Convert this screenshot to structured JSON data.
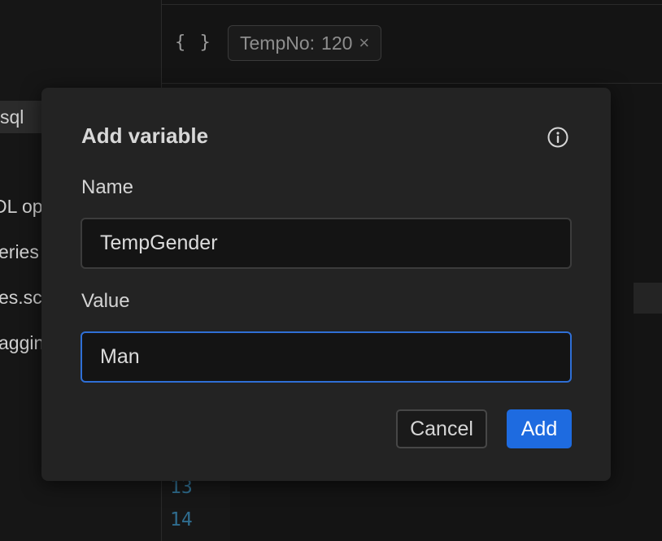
{
  "sidebar": {
    "items": [
      {
        "label": "sql"
      },
      {
        "label": "DL op"
      },
      {
        "label": "eries"
      },
      {
        "label": "es.sc"
      },
      {
        "label": "aggin"
      }
    ]
  },
  "toolbar": {
    "braces_icon": "{ }",
    "variable_chip": {
      "name": "TempNo:",
      "value": "120",
      "close_symbol": "×"
    }
  },
  "editor": {
    "line_numbers": [
      "13",
      "14"
    ]
  },
  "modal": {
    "title": "Add variable",
    "info_icon": "info-icon",
    "name_label": "Name",
    "name_value": "TempGender",
    "value_label": "Value",
    "value_value": "Man",
    "cancel_label": "Cancel",
    "add_label": "Add"
  },
  "colors": {
    "accent": "#1e6be0",
    "focus_border": "#2f6fd6",
    "line_number": "#2f6d8f"
  }
}
